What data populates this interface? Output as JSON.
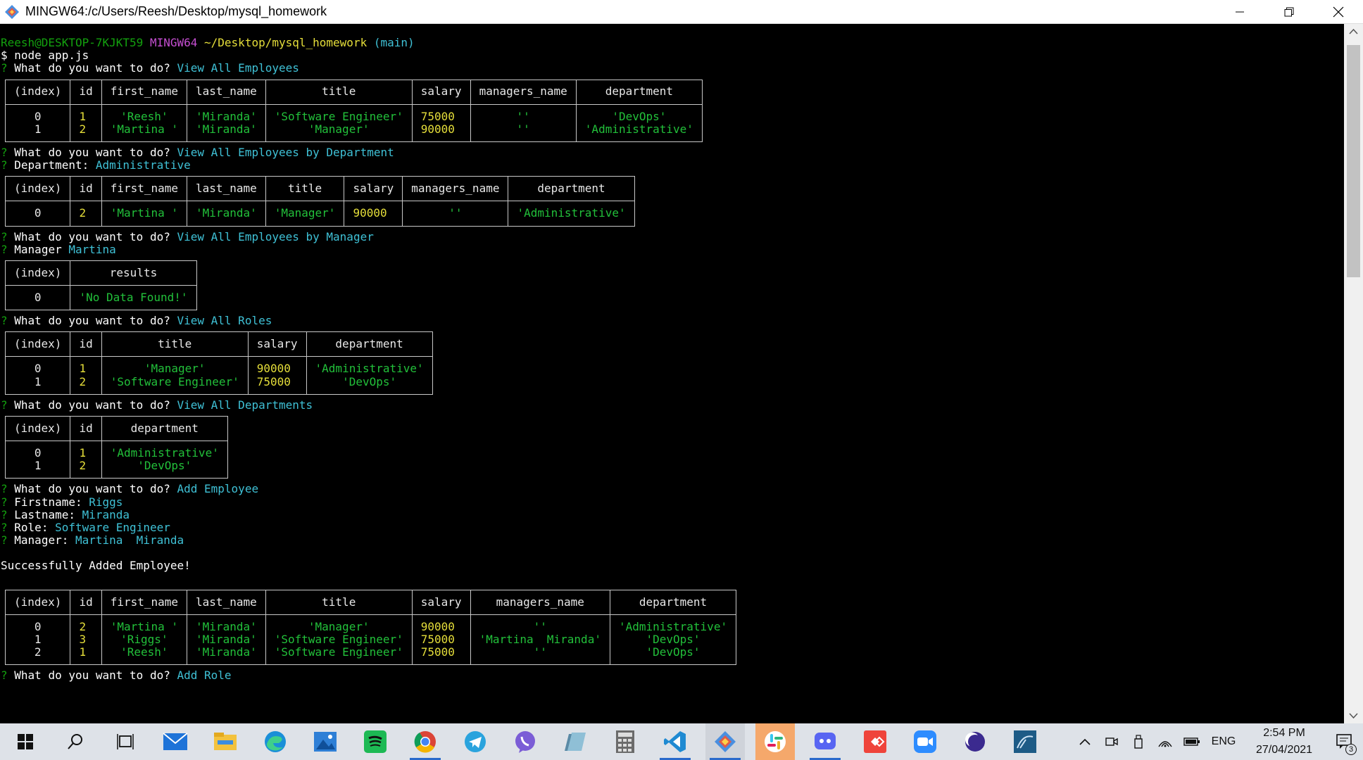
{
  "window": {
    "title": "MINGW64:/c/Users/Reesh/Desktop/mysql_homework"
  },
  "prompt": {
    "user": "Reesh@DESKTOP-7KJKT59",
    "shell": "MINGW64",
    "path": "~/Desktop/mysql_homework",
    "branch": "(main)",
    "command": "$ node app.js"
  },
  "q1": {
    "q": "What do you want to do?",
    "a": "View All Employees"
  },
  "table1": {
    "headers": [
      "(index)",
      "id",
      "first_name",
      "last_name",
      "title",
      "salary",
      "managers_name",
      "department"
    ],
    "rows": [
      [
        "0",
        "1",
        "'Reesh'",
        "'Miranda'",
        "'Software Engineer'",
        "75000",
        "''",
        "'DevOps'"
      ],
      [
        "1",
        "2",
        "'Martina '",
        "'Miranda'",
        "'Manager'",
        "90000",
        "''",
        "'Administrative'"
      ]
    ]
  },
  "q2": {
    "q": "What do you want to do?",
    "a": "View All Employees by Department",
    "sub_label": "Department:",
    "sub_value": "Administrative"
  },
  "table2": {
    "headers": [
      "(index)",
      "id",
      "first_name",
      "last_name",
      "title",
      "salary",
      "managers_name",
      "department"
    ],
    "rows": [
      [
        "0",
        "2",
        "'Martina '",
        "'Miranda'",
        "'Manager'",
        "90000",
        "''",
        "'Administrative'"
      ]
    ]
  },
  "q3": {
    "q": "What do you want to do?",
    "a": "View All Employees by Manager",
    "sub_label": "Manager",
    "sub_value": "Martina"
  },
  "table3": {
    "headers": [
      "(index)",
      "results"
    ],
    "rows": [
      [
        "0",
        "'No Data Found!'"
      ]
    ]
  },
  "q4": {
    "q": "What do you want to do?",
    "a": "View All Roles"
  },
  "table4": {
    "headers": [
      "(index)",
      "id",
      "title",
      "salary",
      "department"
    ],
    "rows": [
      [
        "0",
        "1",
        "'Manager'",
        "90000",
        "'Administrative'"
      ],
      [
        "1",
        "2",
        "'Software Engineer'",
        "75000",
        "'DevOps'"
      ]
    ]
  },
  "q5": {
    "q": "What do you want to do?",
    "a": "View All Departments"
  },
  "table5": {
    "headers": [
      "(index)",
      "id",
      "department"
    ],
    "rows": [
      [
        "0",
        "1",
        "'Administrative'"
      ],
      [
        "1",
        "2",
        "'DevOps'"
      ]
    ]
  },
  "q6": {
    "q": "What do you want to do?",
    "a": "Add Employee",
    "firstname_label": "Firstname:",
    "firstname": "Riggs",
    "lastname_label": "Lastname:",
    "lastname": "Miranda",
    "role_label": "Role:",
    "role": "Software Engineer",
    "manager_label": "Manager:",
    "manager": "Martina  Miranda"
  },
  "success": "Successfully Added Employee!",
  "table6": {
    "headers": [
      "(index)",
      "id",
      "first_name",
      "last_name",
      "title",
      "salary",
      "managers_name",
      "department"
    ],
    "rows": [
      [
        "0",
        "2",
        "'Martina '",
        "'Miranda'",
        "'Manager'",
        "90000",
        "''",
        "'Administrative'"
      ],
      [
        "1",
        "3",
        "'Riggs'",
        "'Miranda'",
        "'Software Engineer'",
        "75000",
        "'Martina  Miranda'",
        "'DevOps'"
      ],
      [
        "2",
        "1",
        "'Reesh'",
        "'Miranda'",
        "'Software Engineer'",
        "75000",
        "''",
        "'DevOps'"
      ]
    ]
  },
  "q7": {
    "q": "What do you want to do?",
    "a": "Add Role"
  },
  "taskbar": {
    "apps": [
      "windows-start",
      "search",
      "task-view",
      "mail",
      "file-explorer",
      "edge",
      "photos",
      "spotify",
      "chrome",
      "telegram",
      "viber",
      "notepad",
      "calculator",
      "vscode",
      "git-bash",
      "slack",
      "discord",
      "anydesk",
      "zoom",
      "eclipse",
      "mysql-workbench"
    ],
    "lang": "ENG",
    "time": "2:54 PM",
    "date": "27/04/2021",
    "notifications": "3"
  }
}
